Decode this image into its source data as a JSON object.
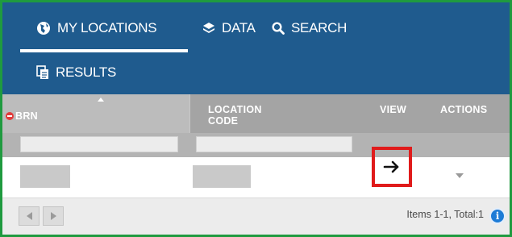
{
  "nav": {
    "tabs": [
      {
        "label": "MY LOCATIONS",
        "icon": "globe-icon",
        "active": true
      },
      {
        "label": "DATA",
        "icon": "layers-icon",
        "active": false
      },
      {
        "label": "SEARCH",
        "icon": "search-icon",
        "active": false
      },
      {
        "label": "RESULTS",
        "icon": "copy-document-icon",
        "active": false
      }
    ]
  },
  "grid": {
    "columns": [
      {
        "label": "BRN",
        "sort_icon": "minus-circle-icon"
      },
      {
        "label_line1": "LOCATION",
        "label_line2": "CODE"
      },
      {
        "label": "VIEW"
      },
      {
        "label": "ACTIONS"
      }
    ],
    "filters": {
      "brn": "",
      "location_code": ""
    },
    "rows": [
      {
        "brn": "",
        "location_code": "",
        "view_icon": "arrow-right-icon",
        "actions_icon": "caret-down-icon"
      }
    ]
  },
  "footer": {
    "items_text": "Items 1-1, Total:1",
    "info_icon_text": "i"
  },
  "colors": {
    "nav_bg": "#1f5b8e",
    "header_bg": "#a4a4a4",
    "highlight_border": "#e01b1b",
    "frame_border": "#1f9a3f",
    "info_icon": "#1d7bd6"
  }
}
